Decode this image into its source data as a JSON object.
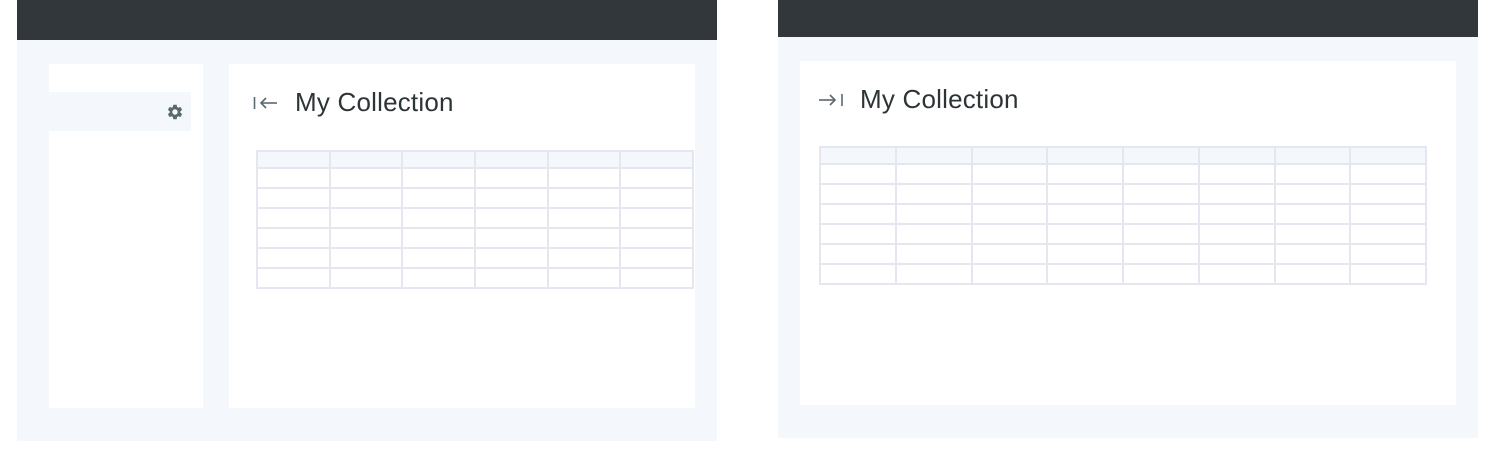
{
  "left_view": {
    "sidebar": {
      "settings_icon": "gear-icon"
    },
    "panel": {
      "toggle_icon": "collapse-sidebar-icon",
      "title": "My Collection"
    },
    "grid": {
      "columns": 6,
      "rows": 7
    }
  },
  "right_view": {
    "panel": {
      "toggle_icon": "expand-sidebar-icon",
      "title": "My Collection"
    },
    "grid": {
      "columns": 8,
      "rows": 7
    }
  },
  "colors": {
    "topbar": "#31373b",
    "background": "#f4f7fc",
    "surface": "#ffffff",
    "grid_line": "#e4e7ef",
    "icon": "#5b6870",
    "text": "#2d3436"
  }
}
